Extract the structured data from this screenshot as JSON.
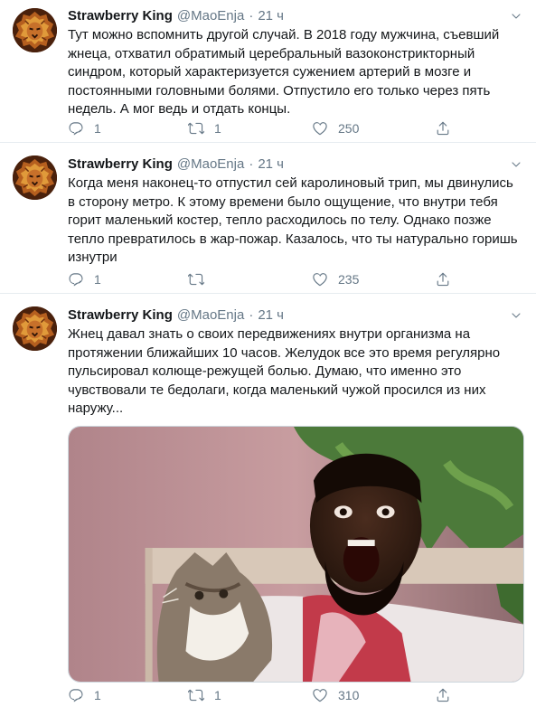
{
  "tweets": [
    {
      "author_name": "Strawberry King",
      "handle": "@MaoEnja",
      "separator": "·",
      "time": "21 ч",
      "text": "Тут можно вспомнить другой случай. В 2018 году мужчина, съевший жнеца, отхватил обратимый церебральный вазоконстрикторный синдром, который характеризуется сужением артерий в мозге и постоянными головными болями. Отпустило его только через пять недель. А мог ведь и отдать концы.",
      "replies": "1",
      "retweets": "1",
      "likes": "250",
      "avatar_icon": "lion-avatar-icon"
    },
    {
      "author_name": "Strawberry King",
      "handle": "@MaoEnja",
      "separator": "·",
      "time": "21 ч",
      "text": "Когда меня наконец-то отпустил сей каролиновый трип, мы двинулись в сторону метро. К этому времени было ощущение, что внутри тебя горит маленький костер, тепло расходилось по телу. Однако позже тепло превратилось в жар-пожар. Казалось, что ты натурально горишь изнутри",
      "replies": "1",
      "retweets": "",
      "likes": "235",
      "avatar_icon": "lion-avatar-icon"
    },
    {
      "author_name": "Strawberry King",
      "handle": "@MaoEnja",
      "separator": "·",
      "time": "21 ч",
      "text": "Жнец давал знать о своих передвижениях внутри организма на протяжении ближайших 10 часов. Желудок все это время регулярно пульсировал колюще-режущей болью. Думаю, что именно это чувствовали те бедолаги, когда маленький чужой просился из них наружу...",
      "replies": "1",
      "retweets": "1",
      "likes": "310",
      "avatar_icon": "lion-avatar-icon",
      "media": "screaming-man-with-cat-photo"
    }
  ],
  "icons": {
    "reply": "reply-icon",
    "retweet": "retweet-icon",
    "like": "heart-icon",
    "share": "share-icon",
    "more": "chevron-down-icon"
  },
  "colors": {
    "text": "#14171a",
    "secondary": "#657786",
    "divider": "#e6ecf0"
  }
}
